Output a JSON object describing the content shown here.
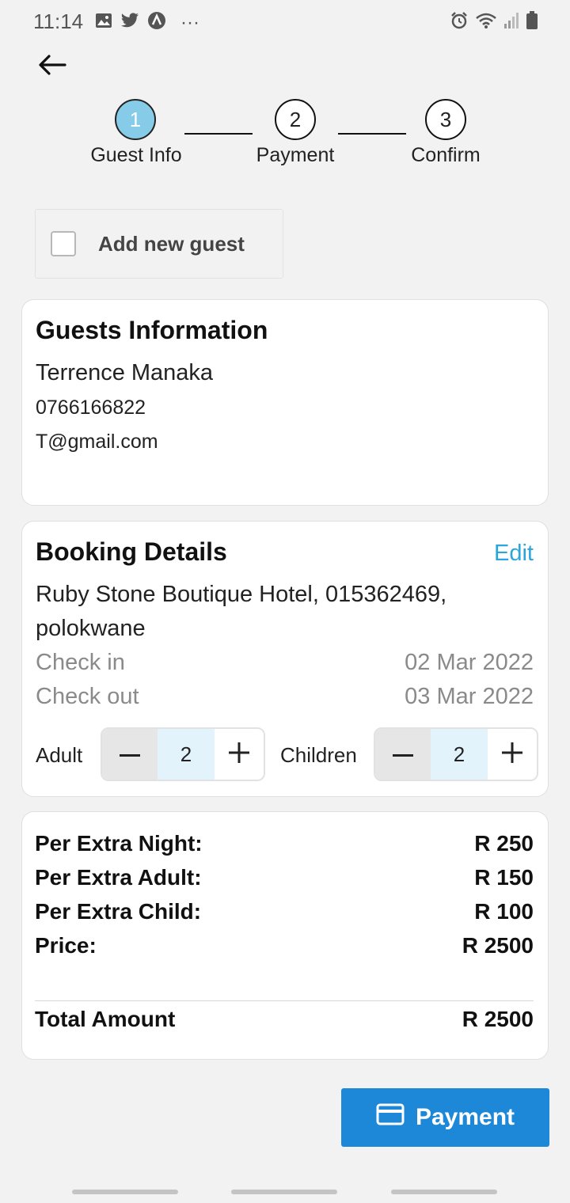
{
  "status_bar": {
    "time": "11:14",
    "more": "···",
    "icons_left": [
      "image-icon",
      "twitter-icon",
      "app-icon"
    ],
    "icons_right": [
      "alarm-icon",
      "wifi-icon",
      "signal-icon",
      "battery-icon"
    ]
  },
  "stepper": {
    "steps": [
      {
        "number": "1",
        "label": "Guest Info",
        "active": true
      },
      {
        "number": "2",
        "label": "Payment",
        "active": false
      },
      {
        "number": "3",
        "label": "Confirm",
        "active": false
      }
    ]
  },
  "add_guest": {
    "label": "Add new guest",
    "checked": false
  },
  "guests": {
    "title": "Guests Information",
    "name": "Terrence Manaka",
    "phone": "0766166822",
    "email": "T@gmail.com"
  },
  "booking": {
    "title": "Booking Details",
    "edit_label": "Edit",
    "hotel_line1": "Ruby Stone Boutique Hotel, 015362469,",
    "hotel_line2": "polokwane",
    "check_in_label": "Check in",
    "check_in_date": "02 Mar 2022",
    "check_out_label": "Check out",
    "check_out_date": "03 Mar 2022",
    "adult_label": "Adult",
    "adult_count": "2",
    "children_label": "Children",
    "children_count": "2"
  },
  "pricing": {
    "rows": [
      {
        "label": "Per Extra Night:",
        "value": "R 250"
      },
      {
        "label": "Per Extra Adult:",
        "value": "R 150"
      },
      {
        "label": "Per Extra Child:",
        "value": "R 100"
      },
      {
        "label": "Price:",
        "value": "R 2500"
      }
    ],
    "total_label": "Total Amount",
    "total_value": "R 2500"
  },
  "payment_button": {
    "label": "Payment"
  },
  "colors": {
    "accent": "#1e88d8",
    "step_active": "#86cce8",
    "link": "#2aa6dc",
    "background": "#f2f2f2"
  }
}
